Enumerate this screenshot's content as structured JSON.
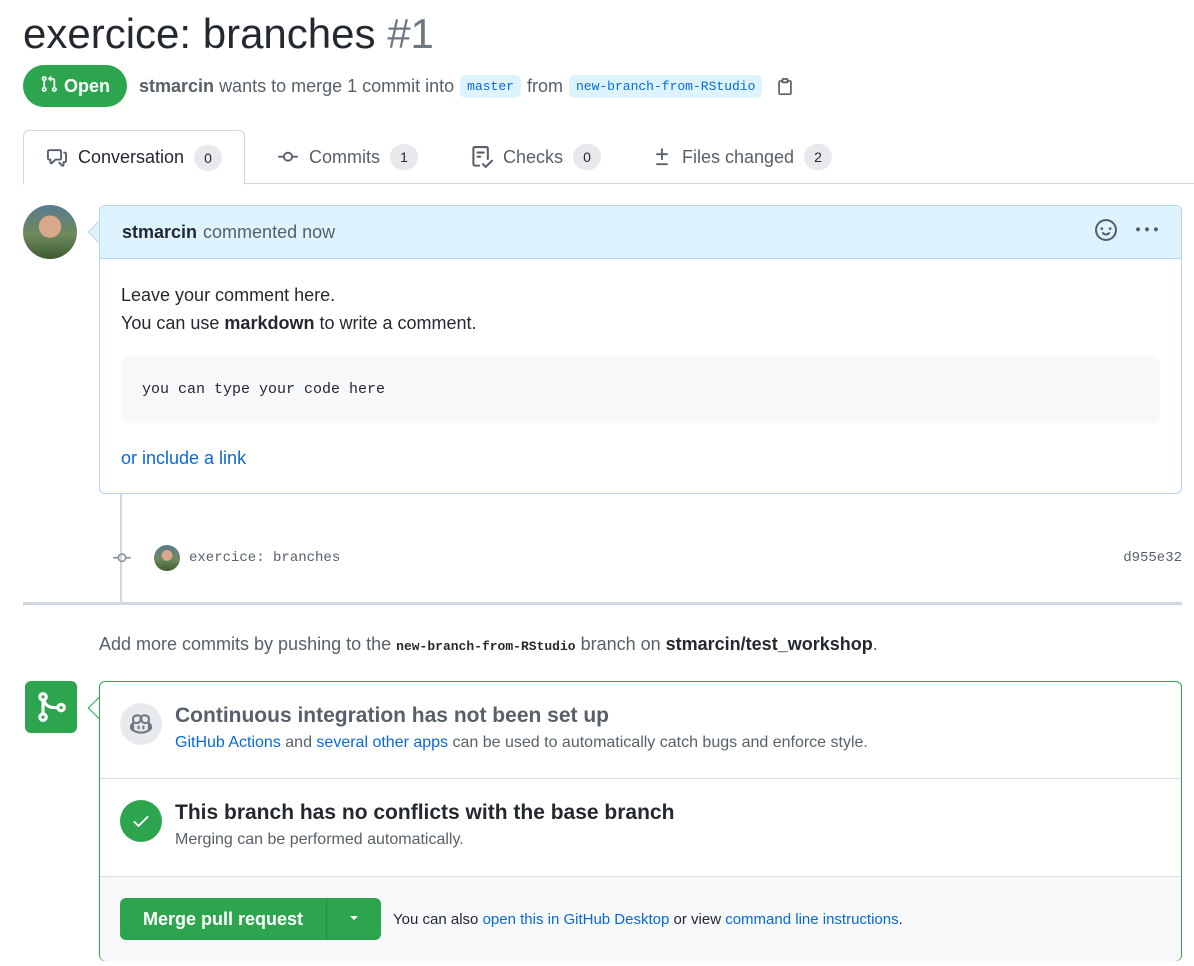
{
  "pr": {
    "title": "exercice: branches",
    "number": "#1",
    "state": "Open",
    "author": "stmarcin",
    "merge_text": "wants to merge 1 commit into",
    "base_branch": "master",
    "from_text": "from",
    "head_branch": "new-branch-from-RStudio"
  },
  "tabs": [
    {
      "label": "Conversation",
      "count": "0"
    },
    {
      "label": "Commits",
      "count": "1"
    },
    {
      "label": "Checks",
      "count": "0"
    },
    {
      "label": "Files changed",
      "count": "2"
    }
  ],
  "comment": {
    "author": "stmarcin",
    "time": "commented now",
    "line1": "Leave your comment here.",
    "line2_pre": "You can use ",
    "line2_bold": "markdown",
    "line2_post": " to write a comment.",
    "code": "you can type your code here",
    "link": "or include a link"
  },
  "commit": {
    "message": "exercice: branches",
    "sha": "d955e32"
  },
  "hint": {
    "pre": "Add more commits by pushing to the ",
    "branch": "new-branch-from-RStudio",
    "mid": " branch on ",
    "repo": "stmarcin/test_workshop",
    "post": "."
  },
  "merge": {
    "ci_title": "Continuous integration has not been set up",
    "ci_link1": "GitHub Actions",
    "ci_and": " and ",
    "ci_link2": "several other apps",
    "ci_rest": " can be used to automatically catch bugs and enforce style.",
    "conflict_title": "This branch has no conflicts with the base branch",
    "conflict_desc": "Merging can be performed automatically.",
    "button": "Merge pull request",
    "alt_pre": "You can also ",
    "alt_link1": "open this in GitHub Desktop",
    "alt_mid": " or view ",
    "alt_link2": "command line instructions",
    "alt_post": "."
  },
  "colors": {
    "open_green": "#2da44e",
    "link_blue": "#0969da",
    "comment_header": "#ddf4ff"
  }
}
